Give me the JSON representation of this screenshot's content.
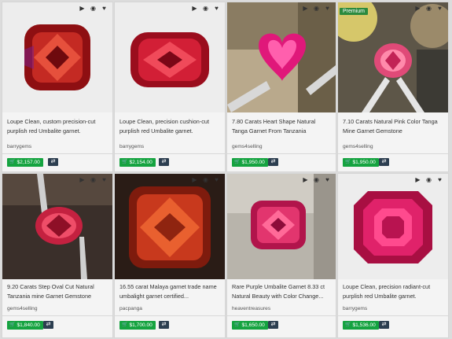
{
  "cards": [
    {
      "title": "Loupe Clean, custom precision-cut purplish red Umbalite garnet.",
      "seller": "barrygems",
      "price": "$2,157.00",
      "premium": ""
    },
    {
      "title": "Loupe Clean, precision cushion-cut purplish red Umbalite garnet.",
      "seller": "barrygems",
      "price": "$2,154.00",
      "premium": ""
    },
    {
      "title": "7.80 Carats Heart Shape Natural Tanga Garnet From Tanzania",
      "seller": "gems4selling",
      "price": "$1,950.00",
      "premium": ""
    },
    {
      "title": "7.10 Carats Natural Pink Color Tanga Mine Garnet Gemstone",
      "seller": "gems4selling",
      "price": "$1,950.00",
      "premium": "Premium"
    },
    {
      "title": "9.20 Carats Step Oval Cut Natural Tanzania mine Garnet Gemstone",
      "seller": "gems4selling",
      "price": "$1,840.00",
      "premium": ""
    },
    {
      "title": "16.55 carat Malaya garnet trade name umbalight garnet certified...",
      "seller": "pacpanga",
      "price": "$1,700.00",
      "premium": ""
    },
    {
      "title": "Rare Purple Umbalite Garnet 8.33 ct Natural Beauty with Color Change...",
      "seller": "heaventreasures",
      "price": "$1,650.00",
      "premium": ""
    },
    {
      "title": "Loupe Clean, precision radiant-cut purplish red Umbalite garnet.",
      "seller": "barrygems",
      "price": "$1,536.00",
      "premium": ""
    }
  ],
  "icons": [
    "video-icon",
    "eye-icon",
    "heart-icon"
  ],
  "colors": {
    "price_bg": "#15a340",
    "swap_bg": "#2c3e50",
    "premium_bg": "#2b8a3e"
  }
}
